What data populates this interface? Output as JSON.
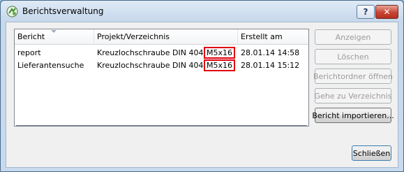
{
  "window": {
    "title": "Berichtsverwaltung"
  },
  "caption": {
    "help": "?",
    "close": "✕"
  },
  "list": {
    "columns": [
      "Bericht",
      "Projekt/Verzeichnis",
      "",
      "Erstellt am"
    ],
    "rows": [
      {
        "name": "report",
        "project": "Kreuzlochschraube DIN 404",
        "size": "M5x16",
        "created": "28.01.14 14:58"
      },
      {
        "name": "Lieferantensuche",
        "project": "Kreuzlochschraube DIN 404",
        "size": "M5x16",
        "created": "28.01.14 15:12"
      }
    ]
  },
  "buttons": {
    "show": "Anzeigen",
    "delete": "Löschen",
    "open_folder": "Berichtordner öffnen",
    "go_to_dir": "Gehe zu Verzeichnis",
    "import": "Bericht importieren...",
    "close": "Schließen"
  }
}
